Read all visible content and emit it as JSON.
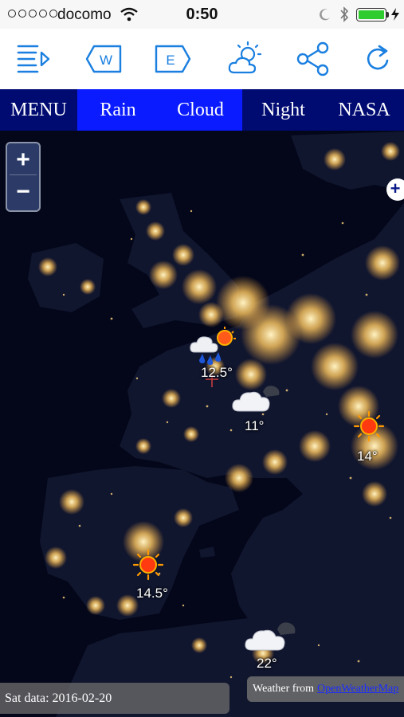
{
  "status_bar": {
    "carrier": "docomo",
    "time": "0:50",
    "battery_level": 1.0,
    "icons": [
      "signal-dots",
      "wifi-icon",
      "moon-icon",
      "bluetooth-icon",
      "battery-icon",
      "charging-icon"
    ]
  },
  "toolbar": {
    "items": [
      {
        "name": "menu-list-icon"
      },
      {
        "name": "west-button",
        "label": "W"
      },
      {
        "name": "east-button",
        "label": "E"
      },
      {
        "name": "sun-cloud-icon"
      },
      {
        "name": "share-icon"
      },
      {
        "name": "refresh-icon"
      }
    ],
    "accent": "#1a7fe0"
  },
  "tabs": [
    {
      "label": "MENU",
      "active": false
    },
    {
      "label": "Rain",
      "active": true
    },
    {
      "label": "Cloud",
      "active": true
    },
    {
      "label": "Night",
      "active": false
    },
    {
      "label": "NASA",
      "active": false
    }
  ],
  "zoom": {
    "in": "+",
    "out": "−"
  },
  "expand_label": "+",
  "weather": [
    {
      "icon": "rain-sun-icon",
      "temp": "12.5°"
    },
    {
      "icon": "cloud-icon",
      "temp": "11°"
    },
    {
      "icon": "sun-icon",
      "temp": "14°"
    },
    {
      "icon": "sun-icon",
      "temp": "14.5°"
    },
    {
      "icon": "cloud-icon",
      "temp": "22°"
    }
  ],
  "footer": {
    "sat_data": "Sat data: 2016-02-20",
    "weather_from": "Weather from",
    "provider_link": "OpenWeatherMap"
  },
  "colors": {
    "tab_bar": "#000b72",
    "tab_active": "#0a1cff",
    "map_background": "#05081c",
    "city_lights": "#ffd27a"
  }
}
